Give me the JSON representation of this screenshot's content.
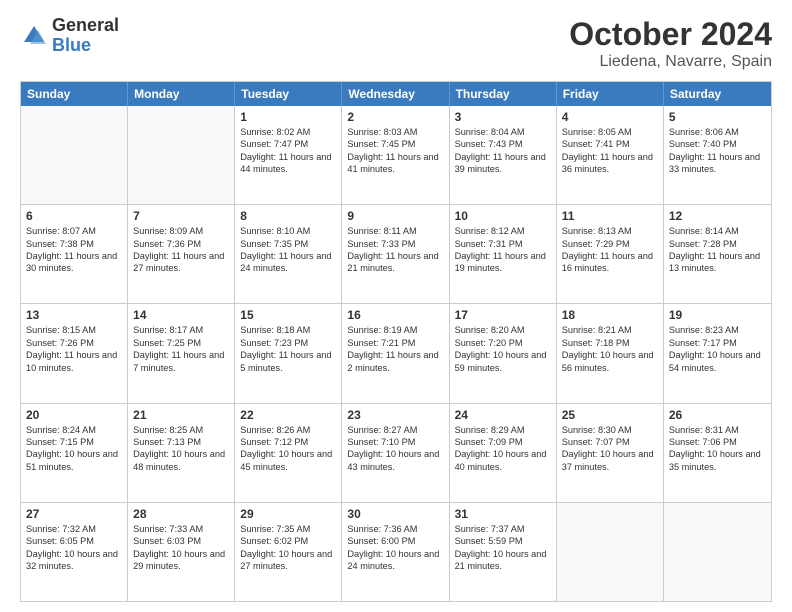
{
  "logo": {
    "general": "General",
    "blue": "Blue"
  },
  "title": "October 2024",
  "location": "Liedena, Navarre, Spain",
  "days": [
    "Sunday",
    "Monday",
    "Tuesday",
    "Wednesday",
    "Thursday",
    "Friday",
    "Saturday"
  ],
  "weeks": [
    [
      {
        "day": "",
        "sunrise": "",
        "sunset": "",
        "daylight": "",
        "empty": true
      },
      {
        "day": "",
        "sunrise": "",
        "sunset": "",
        "daylight": "",
        "empty": true
      },
      {
        "day": "1",
        "sunrise": "Sunrise: 8:02 AM",
        "sunset": "Sunset: 7:47 PM",
        "daylight": "Daylight: 11 hours and 44 minutes."
      },
      {
        "day": "2",
        "sunrise": "Sunrise: 8:03 AM",
        "sunset": "Sunset: 7:45 PM",
        "daylight": "Daylight: 11 hours and 41 minutes."
      },
      {
        "day": "3",
        "sunrise": "Sunrise: 8:04 AM",
        "sunset": "Sunset: 7:43 PM",
        "daylight": "Daylight: 11 hours and 39 minutes."
      },
      {
        "day": "4",
        "sunrise": "Sunrise: 8:05 AM",
        "sunset": "Sunset: 7:41 PM",
        "daylight": "Daylight: 11 hours and 36 minutes."
      },
      {
        "day": "5",
        "sunrise": "Sunrise: 8:06 AM",
        "sunset": "Sunset: 7:40 PM",
        "daylight": "Daylight: 11 hours and 33 minutes."
      }
    ],
    [
      {
        "day": "6",
        "sunrise": "Sunrise: 8:07 AM",
        "sunset": "Sunset: 7:38 PM",
        "daylight": "Daylight: 11 hours and 30 minutes."
      },
      {
        "day": "7",
        "sunrise": "Sunrise: 8:09 AM",
        "sunset": "Sunset: 7:36 PM",
        "daylight": "Daylight: 11 hours and 27 minutes."
      },
      {
        "day": "8",
        "sunrise": "Sunrise: 8:10 AM",
        "sunset": "Sunset: 7:35 PM",
        "daylight": "Daylight: 11 hours and 24 minutes."
      },
      {
        "day": "9",
        "sunrise": "Sunrise: 8:11 AM",
        "sunset": "Sunset: 7:33 PM",
        "daylight": "Daylight: 11 hours and 21 minutes."
      },
      {
        "day": "10",
        "sunrise": "Sunrise: 8:12 AM",
        "sunset": "Sunset: 7:31 PM",
        "daylight": "Daylight: 11 hours and 19 minutes."
      },
      {
        "day": "11",
        "sunrise": "Sunrise: 8:13 AM",
        "sunset": "Sunset: 7:29 PM",
        "daylight": "Daylight: 11 hours and 16 minutes."
      },
      {
        "day": "12",
        "sunrise": "Sunrise: 8:14 AM",
        "sunset": "Sunset: 7:28 PM",
        "daylight": "Daylight: 11 hours and 13 minutes."
      }
    ],
    [
      {
        "day": "13",
        "sunrise": "Sunrise: 8:15 AM",
        "sunset": "Sunset: 7:26 PM",
        "daylight": "Daylight: 11 hours and 10 minutes."
      },
      {
        "day": "14",
        "sunrise": "Sunrise: 8:17 AM",
        "sunset": "Sunset: 7:25 PM",
        "daylight": "Daylight: 11 hours and 7 minutes."
      },
      {
        "day": "15",
        "sunrise": "Sunrise: 8:18 AM",
        "sunset": "Sunset: 7:23 PM",
        "daylight": "Daylight: 11 hours and 5 minutes."
      },
      {
        "day": "16",
        "sunrise": "Sunrise: 8:19 AM",
        "sunset": "Sunset: 7:21 PM",
        "daylight": "Daylight: 11 hours and 2 minutes."
      },
      {
        "day": "17",
        "sunrise": "Sunrise: 8:20 AM",
        "sunset": "Sunset: 7:20 PM",
        "daylight": "Daylight: 10 hours and 59 minutes."
      },
      {
        "day": "18",
        "sunrise": "Sunrise: 8:21 AM",
        "sunset": "Sunset: 7:18 PM",
        "daylight": "Daylight: 10 hours and 56 minutes."
      },
      {
        "day": "19",
        "sunrise": "Sunrise: 8:23 AM",
        "sunset": "Sunset: 7:17 PM",
        "daylight": "Daylight: 10 hours and 54 minutes."
      }
    ],
    [
      {
        "day": "20",
        "sunrise": "Sunrise: 8:24 AM",
        "sunset": "Sunset: 7:15 PM",
        "daylight": "Daylight: 10 hours and 51 minutes."
      },
      {
        "day": "21",
        "sunrise": "Sunrise: 8:25 AM",
        "sunset": "Sunset: 7:13 PM",
        "daylight": "Daylight: 10 hours and 48 minutes."
      },
      {
        "day": "22",
        "sunrise": "Sunrise: 8:26 AM",
        "sunset": "Sunset: 7:12 PM",
        "daylight": "Daylight: 10 hours and 45 minutes."
      },
      {
        "day": "23",
        "sunrise": "Sunrise: 8:27 AM",
        "sunset": "Sunset: 7:10 PM",
        "daylight": "Daylight: 10 hours and 43 minutes."
      },
      {
        "day": "24",
        "sunrise": "Sunrise: 8:29 AM",
        "sunset": "Sunset: 7:09 PM",
        "daylight": "Daylight: 10 hours and 40 minutes."
      },
      {
        "day": "25",
        "sunrise": "Sunrise: 8:30 AM",
        "sunset": "Sunset: 7:07 PM",
        "daylight": "Daylight: 10 hours and 37 minutes."
      },
      {
        "day": "26",
        "sunrise": "Sunrise: 8:31 AM",
        "sunset": "Sunset: 7:06 PM",
        "daylight": "Daylight: 10 hours and 35 minutes."
      }
    ],
    [
      {
        "day": "27",
        "sunrise": "Sunrise: 7:32 AM",
        "sunset": "Sunset: 6:05 PM",
        "daylight": "Daylight: 10 hours and 32 minutes."
      },
      {
        "day": "28",
        "sunrise": "Sunrise: 7:33 AM",
        "sunset": "Sunset: 6:03 PM",
        "daylight": "Daylight: 10 hours and 29 minutes."
      },
      {
        "day": "29",
        "sunrise": "Sunrise: 7:35 AM",
        "sunset": "Sunset: 6:02 PM",
        "daylight": "Daylight: 10 hours and 27 minutes."
      },
      {
        "day": "30",
        "sunrise": "Sunrise: 7:36 AM",
        "sunset": "Sunset: 6:00 PM",
        "daylight": "Daylight: 10 hours and 24 minutes."
      },
      {
        "day": "31",
        "sunrise": "Sunrise: 7:37 AM",
        "sunset": "Sunset: 5:59 PM",
        "daylight": "Daylight: 10 hours and 21 minutes."
      },
      {
        "day": "",
        "sunrise": "",
        "sunset": "",
        "daylight": "",
        "empty": true
      },
      {
        "day": "",
        "sunrise": "",
        "sunset": "",
        "daylight": "",
        "empty": true
      }
    ]
  ]
}
